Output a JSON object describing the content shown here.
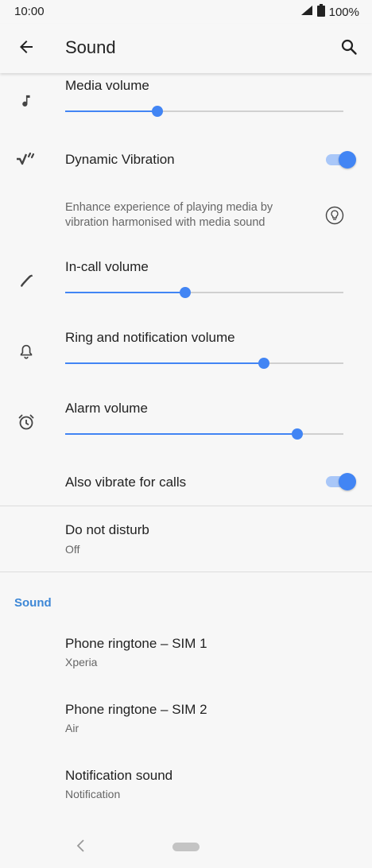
{
  "status_bar": {
    "time": "10:00",
    "battery": "100%",
    "icons": [
      "signal-icon",
      "battery-icon"
    ]
  },
  "toolbar": {
    "title": "Sound",
    "back_icon": "back-arrow-icon",
    "search_icon": "search-icon"
  },
  "settings": {
    "media_volume": {
      "label": "Media volume",
      "icon": "music-note-icon",
      "level": 0.33
    },
    "dynamic_vibration": {
      "label": "Dynamic Vibration",
      "icon": "dynamic-vibration-icon",
      "enabled": true,
      "description": "Enhance experience of playing media by vibration harmonised with media sound",
      "info_icon": "lightbulb-icon"
    },
    "in_call_volume": {
      "label": "In-call volume",
      "icon": "phone-icon",
      "level": 0.43
    },
    "ring_volume": {
      "label": "Ring and notification volume",
      "icon": "bell-icon",
      "level": 0.714
    },
    "alarm_volume": {
      "label": "Alarm volume",
      "icon": "alarm-clock-icon",
      "level": 0.834
    },
    "vibrate_for_calls": {
      "label": "Also vibrate for calls",
      "enabled": true
    },
    "do_not_disturb": {
      "label": "Do not disturb",
      "value": "Off"
    }
  },
  "sound_section": {
    "header": "Sound",
    "items": [
      {
        "label": "Phone ringtone – SIM 1",
        "value": "Xperia"
      },
      {
        "label": "Phone ringtone – SIM 2",
        "value": "Air"
      },
      {
        "label": "Notification sound",
        "value": "Notification"
      }
    ]
  },
  "colors": {
    "accent": "#4285f4",
    "accent_light": "#a9c7f8",
    "section_header": "#3d87d6",
    "background": "#f7f7f7"
  }
}
